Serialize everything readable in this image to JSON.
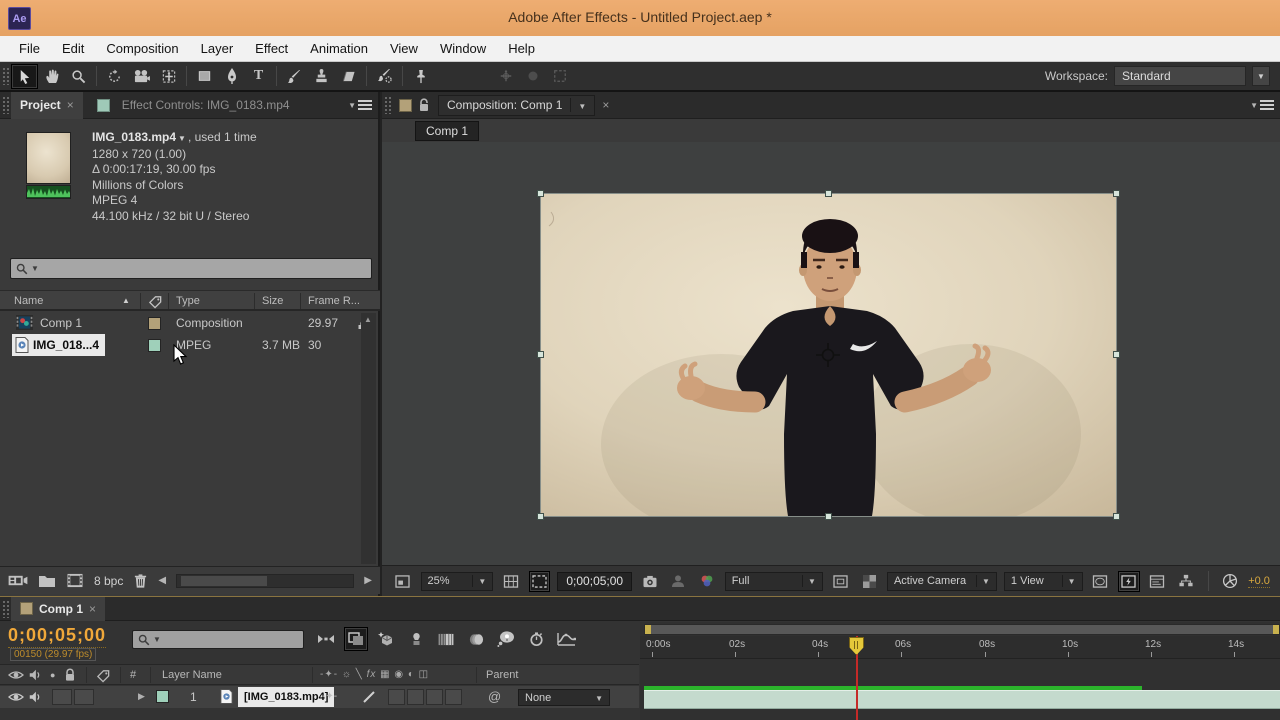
{
  "titlebar": {
    "app_icon": "Ae",
    "title": "Adobe After Effects - Untitled Project.aep *"
  },
  "menubar": {
    "items": [
      "File",
      "Edit",
      "Composition",
      "Layer",
      "Effect",
      "Animation",
      "View",
      "Window",
      "Help"
    ]
  },
  "toolbar": {
    "workspace_label": "Workspace:",
    "workspace_value": "Standard",
    "type_tool_glyph": "T"
  },
  "project_panel": {
    "tab_project": "Project",
    "tab_effect_controls": "Effect Controls: IMG_0183.mp4",
    "footage": {
      "name": "IMG_0183.mp4",
      "usage": ", used 1 time",
      "dimensions": "1280 x 720 (1.00)",
      "duration": "Δ 0:00:17:19, 30.00 fps",
      "depth": "Millions of Colors",
      "codec": "MPEG 4",
      "audio": "44.100 kHz / 32 bit U / Stereo"
    },
    "table": {
      "headers": {
        "name": "Name",
        "type": "Type",
        "size": "Size",
        "frame_rate": "Frame R..."
      },
      "rows": [
        {
          "name": "Comp 1",
          "type": "Composition",
          "size": "",
          "frame_rate": "29.97"
        },
        {
          "name": "IMG_018...4",
          "type": "MPEG",
          "size": "3.7 MB",
          "frame_rate": "30"
        }
      ]
    },
    "bottom": {
      "bpc": "8 bpc"
    }
  },
  "comp_panel": {
    "tab": "Composition: Comp 1",
    "breadcrumb": "Comp 1",
    "toolbar": {
      "zoom": "25%",
      "timecode": "0;00;05;00",
      "resolution": "Full",
      "camera": "Active Camera",
      "view_layout": "1 View",
      "exposure": "+0.0"
    }
  },
  "timeline": {
    "tab": "Comp 1",
    "timecode": "0;00;05;00",
    "frames_info": "00150 (29.97 fps)",
    "columns": {
      "layer_name": "Layer Name",
      "parent": "Parent"
    },
    "layer": {
      "index": "1",
      "name": "[IMG_0183.mp4]",
      "parent": "None"
    },
    "ruler_ticks": [
      "0:00s",
      "02s",
      "04s",
      "06s",
      "08s",
      "10s",
      "12s",
      "14s"
    ]
  },
  "colors": {
    "titlebar_orange": "#e9a76a",
    "timecode_orange": "#f0a83a",
    "footage_teal": "#9fd0ba",
    "comp_tan": "#b3a179",
    "ram_preview_green": "#2cb42c",
    "cti_red": "#c52a28"
  }
}
